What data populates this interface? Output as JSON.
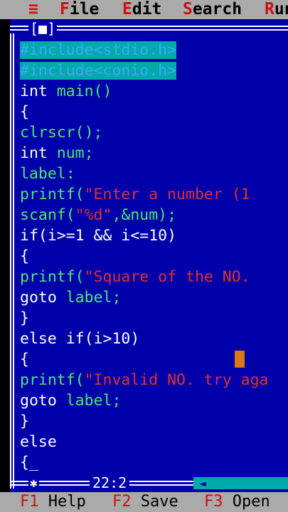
{
  "menu": {
    "hamburger": "≡",
    "file": {
      "hot": "F",
      "rest": "ile"
    },
    "edit": {
      "hot": "E",
      "rest": "dit"
    },
    "search": {
      "hot": "S",
      "rest": "earch"
    },
    "run": {
      "hot": "R",
      "rest": "un"
    }
  },
  "window": {
    "close_box": "[■]",
    "status_star": "✱",
    "cursor_position": "22:2",
    "scroll_left_arrow": "◄"
  },
  "code_lines": [
    [
      {
        "t": "#include<stdio.h>",
        "c": "kw-include"
      }
    ],
    [
      {
        "t": "#include<conio.h>",
        "c": "kw-include"
      }
    ],
    [
      {
        "t": "int ",
        "c": "c-white"
      },
      {
        "t": "main()",
        "c": "c-green"
      }
    ],
    [
      {
        "t": "{",
        "c": "c-white"
      }
    ],
    [
      {
        "t": "clrscr();",
        "c": "c-green"
      }
    ],
    [
      {
        "t": "int ",
        "c": "c-white"
      },
      {
        "t": "num;",
        "c": "c-green"
      }
    ],
    [
      {
        "t": "label:",
        "c": "c-green"
      }
    ],
    [
      {
        "t": "printf(",
        "c": "c-green"
      },
      {
        "t": "\"Enter a number (1 ",
        "c": "c-red"
      }
    ],
    [
      {
        "t": "scanf(",
        "c": "c-green"
      },
      {
        "t": "\"%d\"",
        "c": "c-red"
      },
      {
        "t": ",&num);",
        "c": "c-green"
      }
    ],
    [
      {
        "t": "if(i>=1 && i<=10)",
        "c": "c-white"
      }
    ],
    [
      {
        "t": "{",
        "c": "c-white"
      }
    ],
    [
      {
        "t": "printf(",
        "c": "c-green"
      },
      {
        "t": "\"Square of the NO. ",
        "c": "c-red"
      }
    ],
    [
      {
        "t": "goto ",
        "c": "c-white"
      },
      {
        "t": "label;",
        "c": "c-green"
      }
    ],
    [
      {
        "t": "}",
        "c": "c-white"
      }
    ],
    [
      {
        "t": "else if(i>10)",
        "c": "c-white"
      }
    ],
    [
      {
        "t": "{",
        "c": "c-white"
      }
    ],
    [
      {
        "t": "printf(",
        "c": "c-green"
      },
      {
        "t": "\"Invalid NO. try aga",
        "c": "c-red"
      }
    ],
    [
      {
        "t": "goto ",
        "c": "c-white"
      },
      {
        "t": "label;",
        "c": "c-green"
      }
    ],
    [
      {
        "t": "}",
        "c": "c-white"
      }
    ],
    [
      {
        "t": "else",
        "c": "c-white"
      }
    ],
    [
      {
        "t": "{_",
        "c": "c-cursor"
      }
    ]
  ],
  "fkeys": {
    "help": {
      "key": "F1",
      "label": " Help"
    },
    "save": {
      "key": "F2",
      "label": " Save"
    },
    "open": {
      "key": "F3",
      "label": " Open"
    }
  },
  "colors": {
    "editor_bg": "#0000aa",
    "menu_bg": "#aaaaaa",
    "hotkey": "#cc1010",
    "keyword_white": "#ffffff",
    "identifier_green": "#4ce872",
    "string_red": "#e03030",
    "include_highlight": "#00aaaa"
  }
}
